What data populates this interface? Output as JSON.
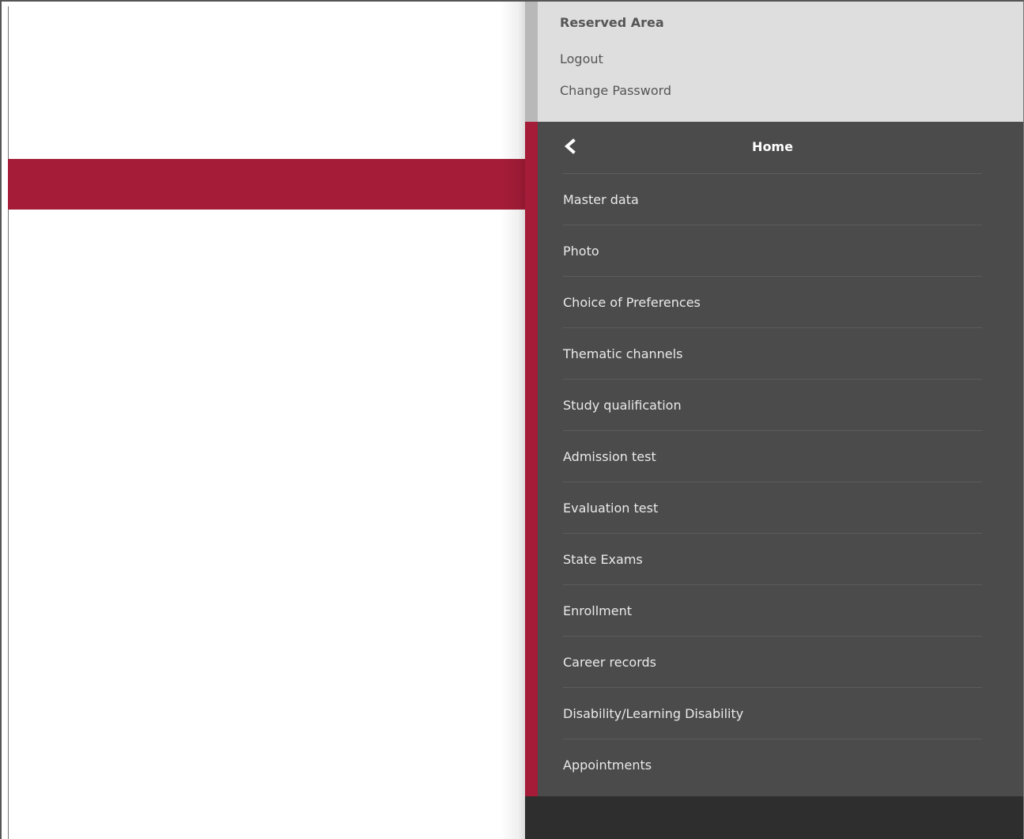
{
  "reserved_area": {
    "title": "Reserved Area",
    "links": [
      "Logout",
      "Change Password"
    ]
  },
  "menu": {
    "home_label": "Home",
    "items": [
      "Master data",
      "Photo",
      "Choice of Preferences",
      "Thematic channels",
      "Study qualification",
      "Admission test",
      "Evaluation test",
      "State Exams",
      "Enrollment",
      "Career records",
      "Disability/Learning Disability",
      "Appointments"
    ]
  },
  "colors": {
    "accent": "#a51c38",
    "menu_bg": "#4b4b4b",
    "reserved_bg": "#dedede",
    "drawer_bottom": "#2e2e2e"
  },
  "icons": {
    "back": "chevron-left-icon"
  }
}
